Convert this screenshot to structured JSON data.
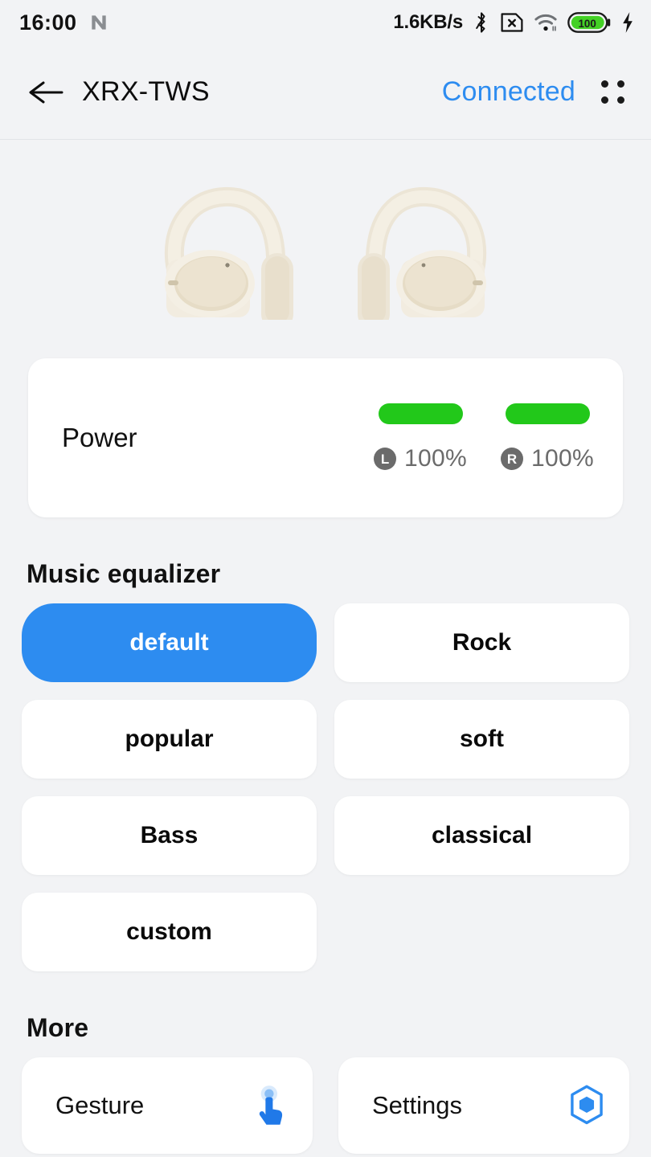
{
  "statusbar": {
    "time": "16:00",
    "nfc_icon": "nfc-icon",
    "network_speed": "1.6KB/s",
    "bluetooth_icon": "bluetooth-icon",
    "sim_icon": "sim-card-disabled-icon",
    "wifi_icon": "wifi-icon",
    "battery_level": "100",
    "charging_icon": "charging-bolt-icon"
  },
  "header": {
    "back_icon": "back-arrow-icon",
    "title": "XRX-TWS",
    "connection_status": "Connected",
    "menu_icon": "grid-menu-icon",
    "status_color": "#2d8cf0"
  },
  "product": {
    "left_bud_name": "left-earbud-image",
    "right_bud_name": "right-earbud-image",
    "body_color": "#efe9dc"
  },
  "power": {
    "label": "Power",
    "bar_color": "#22c81a",
    "buds": [
      {
        "side": "L",
        "percent": "100%",
        "bar_fill": 100
      },
      {
        "side": "R",
        "percent": "100%",
        "bar_fill": 100
      }
    ]
  },
  "equalizer": {
    "heading": "Music equalizer",
    "selected": "default",
    "accent_color": "#2d8cf0",
    "options": [
      {
        "label": "default",
        "selected": true
      },
      {
        "label": "Rock",
        "selected": false
      },
      {
        "label": "popular",
        "selected": false
      },
      {
        "label": "soft",
        "selected": false
      },
      {
        "label": "Bass",
        "selected": false
      },
      {
        "label": "classical",
        "selected": false
      },
      {
        "label": "custom",
        "selected": false
      }
    ]
  },
  "more": {
    "heading": "More",
    "items": [
      {
        "label": "Gesture",
        "icon": "tap-gesture-icon"
      },
      {
        "label": "Settings",
        "icon": "hexagon-settings-icon"
      }
    ]
  }
}
